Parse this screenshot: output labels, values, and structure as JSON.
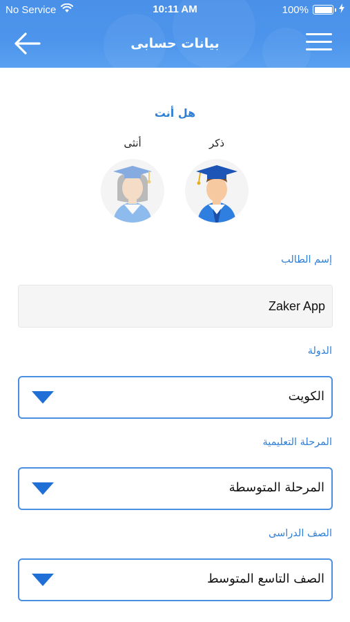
{
  "status_bar": {
    "carrier": "No Service",
    "time": "10:11 AM",
    "battery": "100%"
  },
  "nav": {
    "title": "بيانات حسابى",
    "back_icon": "arrow-left-icon",
    "menu_icon": "hamburger-menu-icon"
  },
  "gender": {
    "question": "هل أنت",
    "male_label": "ذكر",
    "female_label": "أنثى",
    "selected": "male"
  },
  "student_name": {
    "label": "إسم الطالب",
    "value": "Zaker App"
  },
  "country": {
    "label": "الدولة",
    "value": "الكويت"
  },
  "stage": {
    "label": "المرحلة التعليمية",
    "value": "المرحلة المتوسطة"
  },
  "grade": {
    "label": "الصف الدراسى",
    "value": "الصف التاسع المتوسط"
  },
  "colors": {
    "header": "#4a90e8",
    "accent": "#2f7fd6",
    "select_border": "#4a8fe0",
    "arrow": "#1f6fd6"
  }
}
